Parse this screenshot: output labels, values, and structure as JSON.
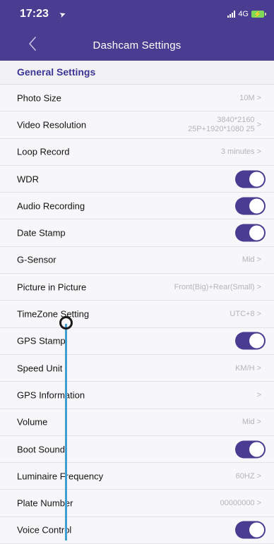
{
  "status_bar": {
    "time": "17:23",
    "location_icon": "location-arrow-icon",
    "network": "4G",
    "battery_icon": "battery-charging-icon"
  },
  "nav": {
    "title": "Dashcam Settings",
    "back_icon": "chevron-left-icon"
  },
  "section": {
    "title": "General Settings"
  },
  "rows": [
    {
      "label": "Photo Size",
      "value": "10M",
      "kind": "value"
    },
    {
      "label": "Video Resolution",
      "value_lines": [
        "3840*2160",
        "25P+1920*1080 25"
      ],
      "kind": "multi"
    },
    {
      "label": "Loop Record",
      "value": "3 minutes",
      "kind": "value"
    },
    {
      "label": "WDR",
      "kind": "toggle",
      "on": true
    },
    {
      "label": "Audio Recording",
      "kind": "toggle",
      "on": true
    },
    {
      "label": "Date Stamp",
      "kind": "toggle",
      "on": true
    },
    {
      "label": "G-Sensor",
      "value": "Mid",
      "kind": "value"
    },
    {
      "label": "Picture in Picture",
      "value": "Front(Big)+Rear(Small)",
      "kind": "value"
    },
    {
      "label": "TimeZone Setting",
      "value": "UTC+8",
      "kind": "value"
    },
    {
      "label": "GPS Stamp",
      "kind": "toggle",
      "on": true
    },
    {
      "label": "Speed Unit",
      "value": "KM/H",
      "kind": "value"
    },
    {
      "label": "GPS Information",
      "value": "",
      "kind": "value"
    },
    {
      "label": "Volume",
      "value": "Mid",
      "kind": "value"
    },
    {
      "label": "Boot Sound",
      "kind": "toggle",
      "on": true
    },
    {
      "label": "Luminaire Frequency",
      "value": "60HZ",
      "kind": "value"
    },
    {
      "label": "Plate Number",
      "value": "00000000",
      "kind": "value"
    },
    {
      "label": "Voice Control",
      "kind": "toggle",
      "on": true
    }
  ],
  "chevron_glyph": ">",
  "colors": {
    "header_bg": "#4a3c91",
    "section_title": "#3c3596",
    "toggle_on": "#4a3c91",
    "value_text": "#b4b4ba",
    "drag_line": "#3f9fd1"
  }
}
